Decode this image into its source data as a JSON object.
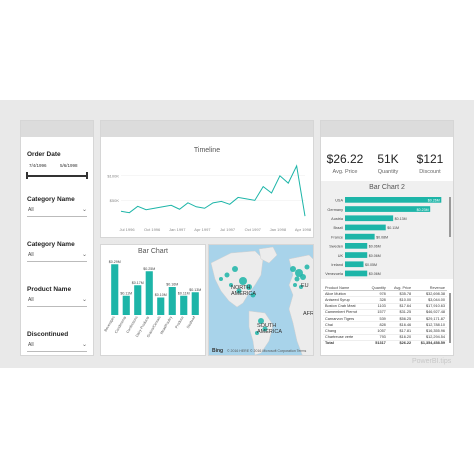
{
  "slicers": {
    "order_date": {
      "title": "Order Date",
      "from": "7/4/1996",
      "to": "5/6/1998"
    },
    "category_name_1": {
      "title": "Category Name",
      "value": "All"
    },
    "category_name_2": {
      "title": "Category Name",
      "value": "All"
    },
    "product_name": {
      "title": "Product Name",
      "value": "All"
    },
    "discontinued": {
      "title": "Discontinued",
      "value": "All"
    }
  },
  "kpis": [
    {
      "value": "$26.22",
      "label": "Avg. Price"
    },
    {
      "value": "51K",
      "label": "Quantity"
    },
    {
      "value": "$121",
      "label": "Discount"
    }
  ],
  "map": {
    "labels": {
      "north_america": "NORTH AMERICA",
      "south_america": "SOUTH AMERICA",
      "europe": "EU",
      "africa": "AFR"
    },
    "bing": "Bing",
    "copyright": "© 2016 HERE © 2016 Microsoft Corporation Terms"
  },
  "table": {
    "headers": [
      "Product Name",
      "Quantity",
      "Avg. Price",
      "Revenue"
    ],
    "rows": [
      [
        "Alice Mutton",
        "978",
        "$35.78",
        "$32,698.38"
      ],
      [
        "Aniseed Syrup",
        "328",
        "$10.00",
        "$3,044.00"
      ],
      [
        "Boston Crab Meat",
        "1103",
        "$17.64",
        "$17,910.63"
      ],
      [
        "Camembert Pierrot",
        "1577",
        "$31.25",
        "$46,927.48"
      ],
      [
        "Carnarvon Tigers",
        "539",
        "$56.25",
        "$29,171.87"
      ],
      [
        "Chai",
        "828",
        "$16.46",
        "$12,788.10"
      ],
      [
        "Chang",
        "1057",
        "$17.81",
        "$16,355.96"
      ],
      [
        "Chartreuse verte",
        "793",
        "$16.20",
        "$12,294.54"
      ]
    ],
    "total": [
      "Total",
      "51317",
      "$26.22",
      "$1,354,458.59"
    ]
  },
  "watermark": "PowerBI.tips",
  "chart_data": [
    {
      "type": "line",
      "title": "Timeline",
      "x_ticks": [
        "Jul 1996",
        "Oct 1996",
        "Jan 1997",
        "Apr 1997",
        "Jul 1997",
        "Oct 1997",
        "Jan 1998",
        "Apr 1998"
      ],
      "y_ticks": [
        "$100K",
        "$50K"
      ],
      "ylim": [
        0,
        130
      ],
      "values": [
        28,
        25,
        38,
        31,
        34,
        37,
        40,
        32,
        45,
        37,
        34,
        45,
        48,
        42,
        56,
        53,
        50,
        78,
        65,
        100,
        85,
        120,
        18
      ],
      "color": "#1db5a8"
    },
    {
      "type": "bar",
      "title": "Bar Chart",
      "categories": [
        "Beverages",
        "Condiments",
        "Confections",
        "Dairy Products",
        "Grains/Cereals",
        "Meat/Poultry",
        "Produce",
        "Seafood"
      ],
      "values": [
        0.29,
        0.11,
        0.17,
        0.25,
        0.1,
        0.16,
        0.11,
        0.13
      ],
      "data_labels": [
        "$0.29M",
        "$0.11M",
        "$0.17M",
        "$0.25M",
        "$0.10M",
        "$0.16M",
        "$0.11M",
        "$0.13M"
      ],
      "ylim": [
        0,
        0.32
      ],
      "color": "#1db5a8"
    },
    {
      "type": "bar",
      "orientation": "horizontal",
      "title": "Bar Chart 2",
      "categories": [
        "USA",
        "Germany",
        "Austria",
        "Brazil",
        "France",
        "Sweden",
        "UK",
        "Ireland",
        "Venezuela"
      ],
      "values": [
        0.26,
        0.23,
        0.13,
        0.11,
        0.08,
        0.06,
        0.06,
        0.05,
        0.06
      ],
      "data_labels": [
        "$0.26M",
        "$0.23M",
        "$0.13M",
        "$0.11M",
        "$0.08M",
        "$0.06M",
        "$0.06M",
        "$0.05M",
        "$0.06M"
      ],
      "xlim": [
        0,
        0.27
      ],
      "color": "#1db5a8"
    }
  ]
}
